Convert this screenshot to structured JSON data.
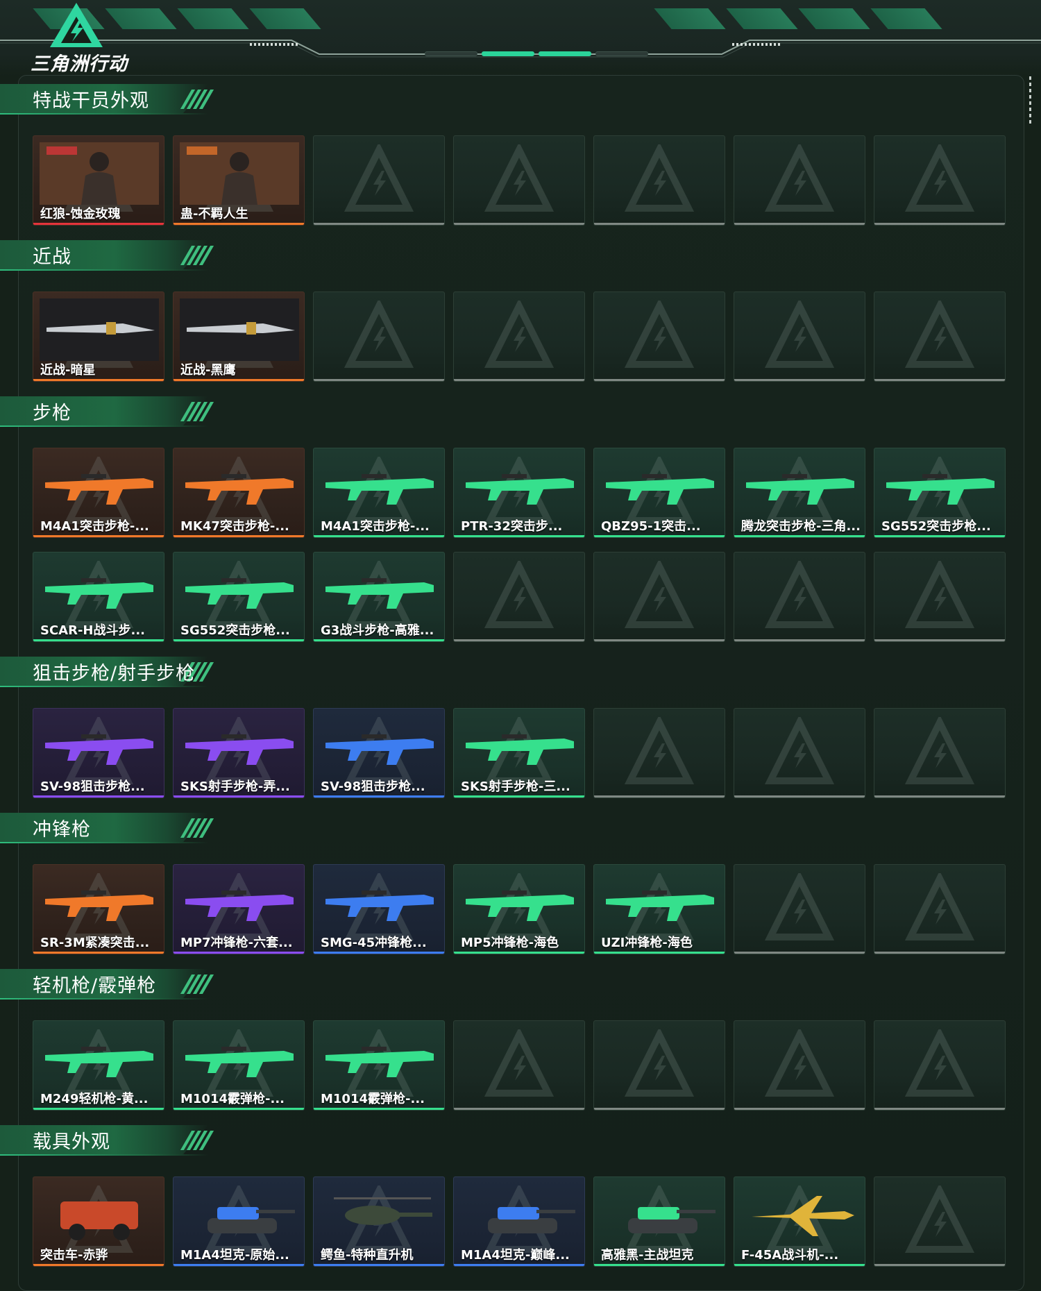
{
  "app": {
    "logo_text": "三角洲行动"
  },
  "header": {
    "pager_active": [
      2,
      3
    ]
  },
  "colors": {
    "orange": "#f0792a",
    "red": "#e5343b",
    "green": "#36e08d",
    "purple": "#8a4df0",
    "blue": "#3d7df0",
    "grey": "#7f8883"
  },
  "sections": [
    {
      "title": "特战干员外观",
      "items": [
        {
          "label": "红狼-蚀金玫瑰",
          "rarity": "red",
          "icon": "operator-icon"
        },
        {
          "label": "蛊-不羁人生",
          "rarity": "orange",
          "icon": "operator-icon"
        },
        {
          "label": "",
          "rarity": "empty"
        },
        {
          "label": "",
          "rarity": "empty"
        },
        {
          "label": "",
          "rarity": "empty"
        },
        {
          "label": "",
          "rarity": "empty"
        },
        {
          "label": "",
          "rarity": "empty"
        }
      ]
    },
    {
      "title": "近战",
      "items": [
        {
          "label": "近战-暗星",
          "rarity": "orange",
          "icon": "knife-icon"
        },
        {
          "label": "近战-黑鹰",
          "rarity": "orange",
          "icon": "knife-icon"
        },
        {
          "label": "",
          "rarity": "empty"
        },
        {
          "label": "",
          "rarity": "empty"
        },
        {
          "label": "",
          "rarity": "empty"
        },
        {
          "label": "",
          "rarity": "empty"
        },
        {
          "label": "",
          "rarity": "empty"
        }
      ]
    },
    {
      "title": "步枪",
      "items": [
        {
          "label": "M4A1突击步枪-...",
          "rarity": "orange",
          "icon": "rifle-icon"
        },
        {
          "label": "MK47突击步枪-...",
          "rarity": "orange",
          "icon": "rifle-icon"
        },
        {
          "label": "M4A1突击步枪-...",
          "rarity": "green",
          "icon": "rifle-icon"
        },
        {
          "label": "PTR-32突击步...",
          "rarity": "green",
          "icon": "rifle-icon"
        },
        {
          "label": "QBZ95-1突击...",
          "rarity": "green",
          "icon": "rifle-icon"
        },
        {
          "label": "腾龙突击步枪-三角...",
          "rarity": "green",
          "icon": "rifle-icon"
        },
        {
          "label": "SG552突击步枪...",
          "rarity": "green",
          "icon": "rifle-icon"
        },
        {
          "label": "SCAR-H战斗步...",
          "rarity": "green",
          "icon": "rifle-icon"
        },
        {
          "label": "SG552突击步枪...",
          "rarity": "green",
          "icon": "rifle-icon"
        },
        {
          "label": "G3战斗步枪-高雅...",
          "rarity": "green",
          "icon": "rifle-icon"
        },
        {
          "label": "",
          "rarity": "empty"
        },
        {
          "label": "",
          "rarity": "empty"
        },
        {
          "label": "",
          "rarity": "empty"
        },
        {
          "label": "",
          "rarity": "empty"
        }
      ]
    },
    {
      "title": "狙击步枪/射手步枪",
      "items": [
        {
          "label": "SV-98狙击步枪...",
          "rarity": "purple",
          "icon": "sniper-icon"
        },
        {
          "label": "SKS射手步枪-弄...",
          "rarity": "purple",
          "icon": "sniper-icon"
        },
        {
          "label": "SV-98狙击步枪...",
          "rarity": "blue",
          "icon": "sniper-icon"
        },
        {
          "label": "SKS射手步枪-三...",
          "rarity": "green",
          "icon": "sniper-icon"
        },
        {
          "label": "",
          "rarity": "empty"
        },
        {
          "label": "",
          "rarity": "empty"
        },
        {
          "label": "",
          "rarity": "empty"
        }
      ]
    },
    {
      "title": "冲锋枪",
      "items": [
        {
          "label": "SR-3M紧凑突击...",
          "rarity": "orange",
          "icon": "smg-icon"
        },
        {
          "label": "MP7冲锋枪-六套...",
          "rarity": "purple",
          "icon": "smg-icon"
        },
        {
          "label": "SMG-45冲锋枪...",
          "rarity": "blue",
          "icon": "smg-icon"
        },
        {
          "label": "MP5冲锋枪-海色",
          "rarity": "green",
          "icon": "smg-icon"
        },
        {
          "label": "UZI冲锋枪-海色",
          "rarity": "green",
          "icon": "smg-icon"
        },
        {
          "label": "",
          "rarity": "empty"
        },
        {
          "label": "",
          "rarity": "empty"
        }
      ]
    },
    {
      "title": "轻机枪/霰弹枪",
      "items": [
        {
          "label": "M249轻机枪-黄...",
          "rarity": "green",
          "icon": "lmg-icon"
        },
        {
          "label": "M1014霰弹枪-...",
          "rarity": "green",
          "icon": "shotgun-icon"
        },
        {
          "label": "M1014霰弹枪-...",
          "rarity": "green",
          "icon": "shotgun-icon"
        },
        {
          "label": "",
          "rarity": "empty"
        },
        {
          "label": "",
          "rarity": "empty"
        },
        {
          "label": "",
          "rarity": "empty"
        },
        {
          "label": "",
          "rarity": "empty"
        }
      ]
    },
    {
      "title": "载具外观",
      "items": [
        {
          "label": "突击车-赤骅",
          "rarity": "orange",
          "icon": "vehicle-icon"
        },
        {
          "label": "M1A4坦克-原始...",
          "rarity": "blue",
          "icon": "tank-icon"
        },
        {
          "label": "鳄鱼-特种直升机",
          "rarity": "blue",
          "icon": "helicopter-icon"
        },
        {
          "label": "M1A4坦克-巅峰...",
          "rarity": "blue",
          "icon": "tank-icon"
        },
        {
          "label": "高雅黑-主战坦克",
          "rarity": "green",
          "icon": "tank-icon"
        },
        {
          "label": "F-45A战斗机-...",
          "rarity": "green",
          "icon": "jet-icon"
        },
        {
          "label": "",
          "rarity": "empty"
        }
      ]
    }
  ]
}
